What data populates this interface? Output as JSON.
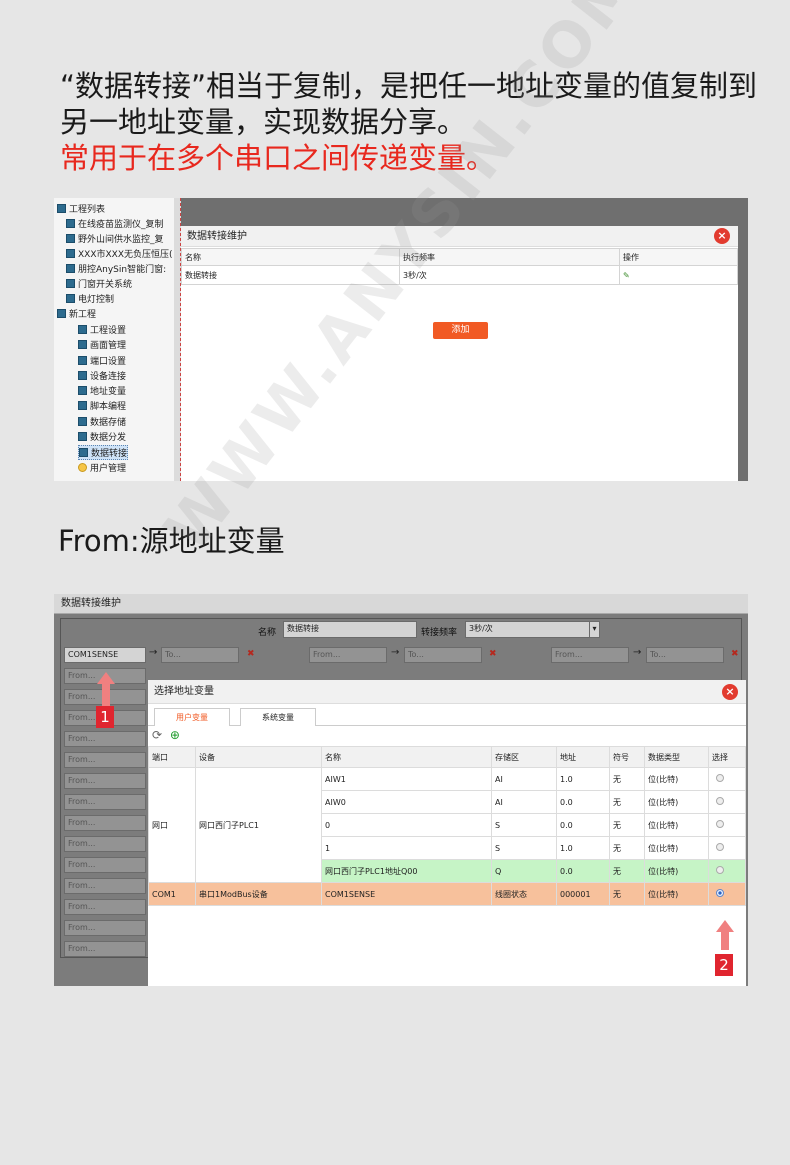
{
  "intro": {
    "line1": "“数据转接”相当于复制，是把任一地址变量的值复制到另一地址变量，实现数据分享。",
    "line2": "常用于在多个串口之间传递变量。"
  },
  "from_title": "From:源地址变量",
  "watermark": "WWW.ANYSIN.COM",
  "tree": {
    "root": "工程列表",
    "items": [
      "在线疫苗监测仪_复制",
      "野外山间供水监控_复",
      "XXX市XXX无负压恒压(",
      "朋控AnySin智能门窗:",
      "门窗开关系统",
      "电灯控制",
      "新工程"
    ],
    "children": [
      "工程设置",
      "画面管理",
      "端口设置",
      "设备连接",
      "地址变量",
      "脚本编程",
      "数据存储",
      "数据分发",
      "数据转接",
      "用户管理"
    ]
  },
  "dialog1": {
    "title": "数据转接维护",
    "columns": [
      "名称",
      "执行频率",
      "操作"
    ],
    "rows": [
      [
        "数据转接",
        "3秒/次"
      ]
    ],
    "add_label": "添加"
  },
  "form": {
    "title": "数据转接维护",
    "name_label": "名称",
    "name_value": "数据转接",
    "freq_label": "转接频率",
    "freq_value": "3秒/次",
    "first_from": "COM1SENSE",
    "from_placeholder": "From...",
    "to_placeholder": "To..."
  },
  "dialog2": {
    "title": "选择地址变量",
    "tabs": [
      "用户变量",
      "系统变量"
    ],
    "columns": [
      "端口",
      "设备",
      "名称",
      "存储区",
      "地址",
      "符号",
      "数据类型",
      "选择"
    ],
    "rows": [
      {
        "port": "网口",
        "device": "网口西门子PLC1",
        "name": "AIW1",
        "area": "AI",
        "addr": "1.0",
        "sign": "无",
        "type": "位(比特)"
      },
      {
        "port": "",
        "device": "",
        "name": "AIW0",
        "area": "AI",
        "addr": "0.0",
        "sign": "无",
        "type": "位(比特)"
      },
      {
        "port": "",
        "device": "",
        "name": "0",
        "area": "S",
        "addr": "0.0",
        "sign": "无",
        "type": "位(比特)"
      },
      {
        "port": "",
        "device": "",
        "name": "1",
        "area": "S",
        "addr": "1.0",
        "sign": "无",
        "type": "位(比特)"
      },
      {
        "port": "",
        "device": "",
        "name": "网口西门子PLC1地址Q00",
        "area": "Q",
        "addr": "0.0",
        "sign": "无",
        "type": "位(比特)"
      },
      {
        "port": "COM1",
        "device": "串口1ModBus设备",
        "name": "COM1SENSE",
        "area": "线圈状态",
        "addr": "000001",
        "sign": "无",
        "type": "位(比特)"
      }
    ]
  },
  "badges": [
    "1",
    "2"
  ],
  "colors": {
    "accent": "#f15a24",
    "red_text": "#e8281e",
    "green_row": "#c6f4c6",
    "orange_row": "#f7c19c"
  }
}
